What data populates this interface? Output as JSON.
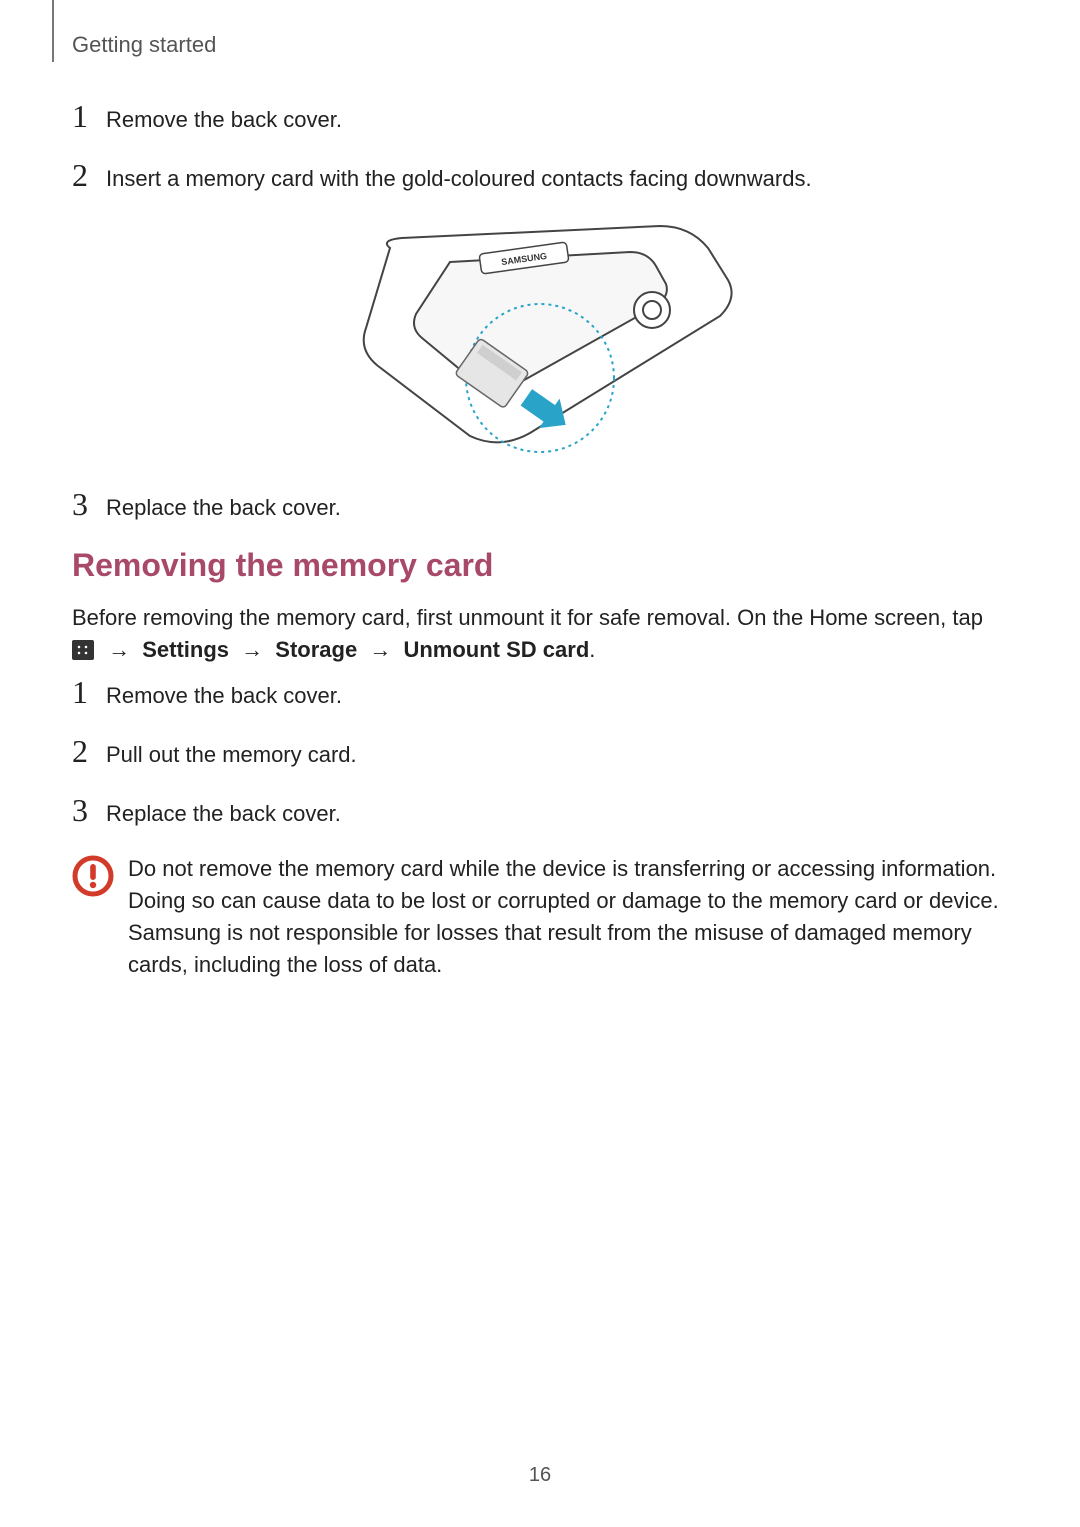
{
  "header": {
    "section": "Getting started"
  },
  "steps_a": [
    {
      "n": "1",
      "text": "Remove the back cover."
    },
    {
      "n": "2",
      "text": "Insert a memory card with the gold-coloured contacts facing downwards."
    },
    {
      "n": "3",
      "text": "Replace the back cover."
    }
  ],
  "section_title": "Removing the memory card",
  "intro": {
    "line1": "Before removing the memory card, first unmount it for safe removal. On the Home screen, tap ",
    "path": {
      "a": "Settings",
      "b": "Storage",
      "c": "Unmount SD card"
    },
    "period": "."
  },
  "steps_b": [
    {
      "n": "1",
      "text": "Remove the back cover."
    },
    {
      "n": "2",
      "text": "Pull out the memory card."
    },
    {
      "n": "3",
      "text": "Replace the back cover."
    }
  ],
  "caution": "Do not remove the memory card while the device is transferring or accessing information. Doing so can cause data to be lost or corrupted or damage to the memory card or device. Samsung is not responsible for losses that result from the misuse of damaged memory cards, including the loss of data.",
  "illustration_label": "SAMSUNG",
  "page_number": "16"
}
